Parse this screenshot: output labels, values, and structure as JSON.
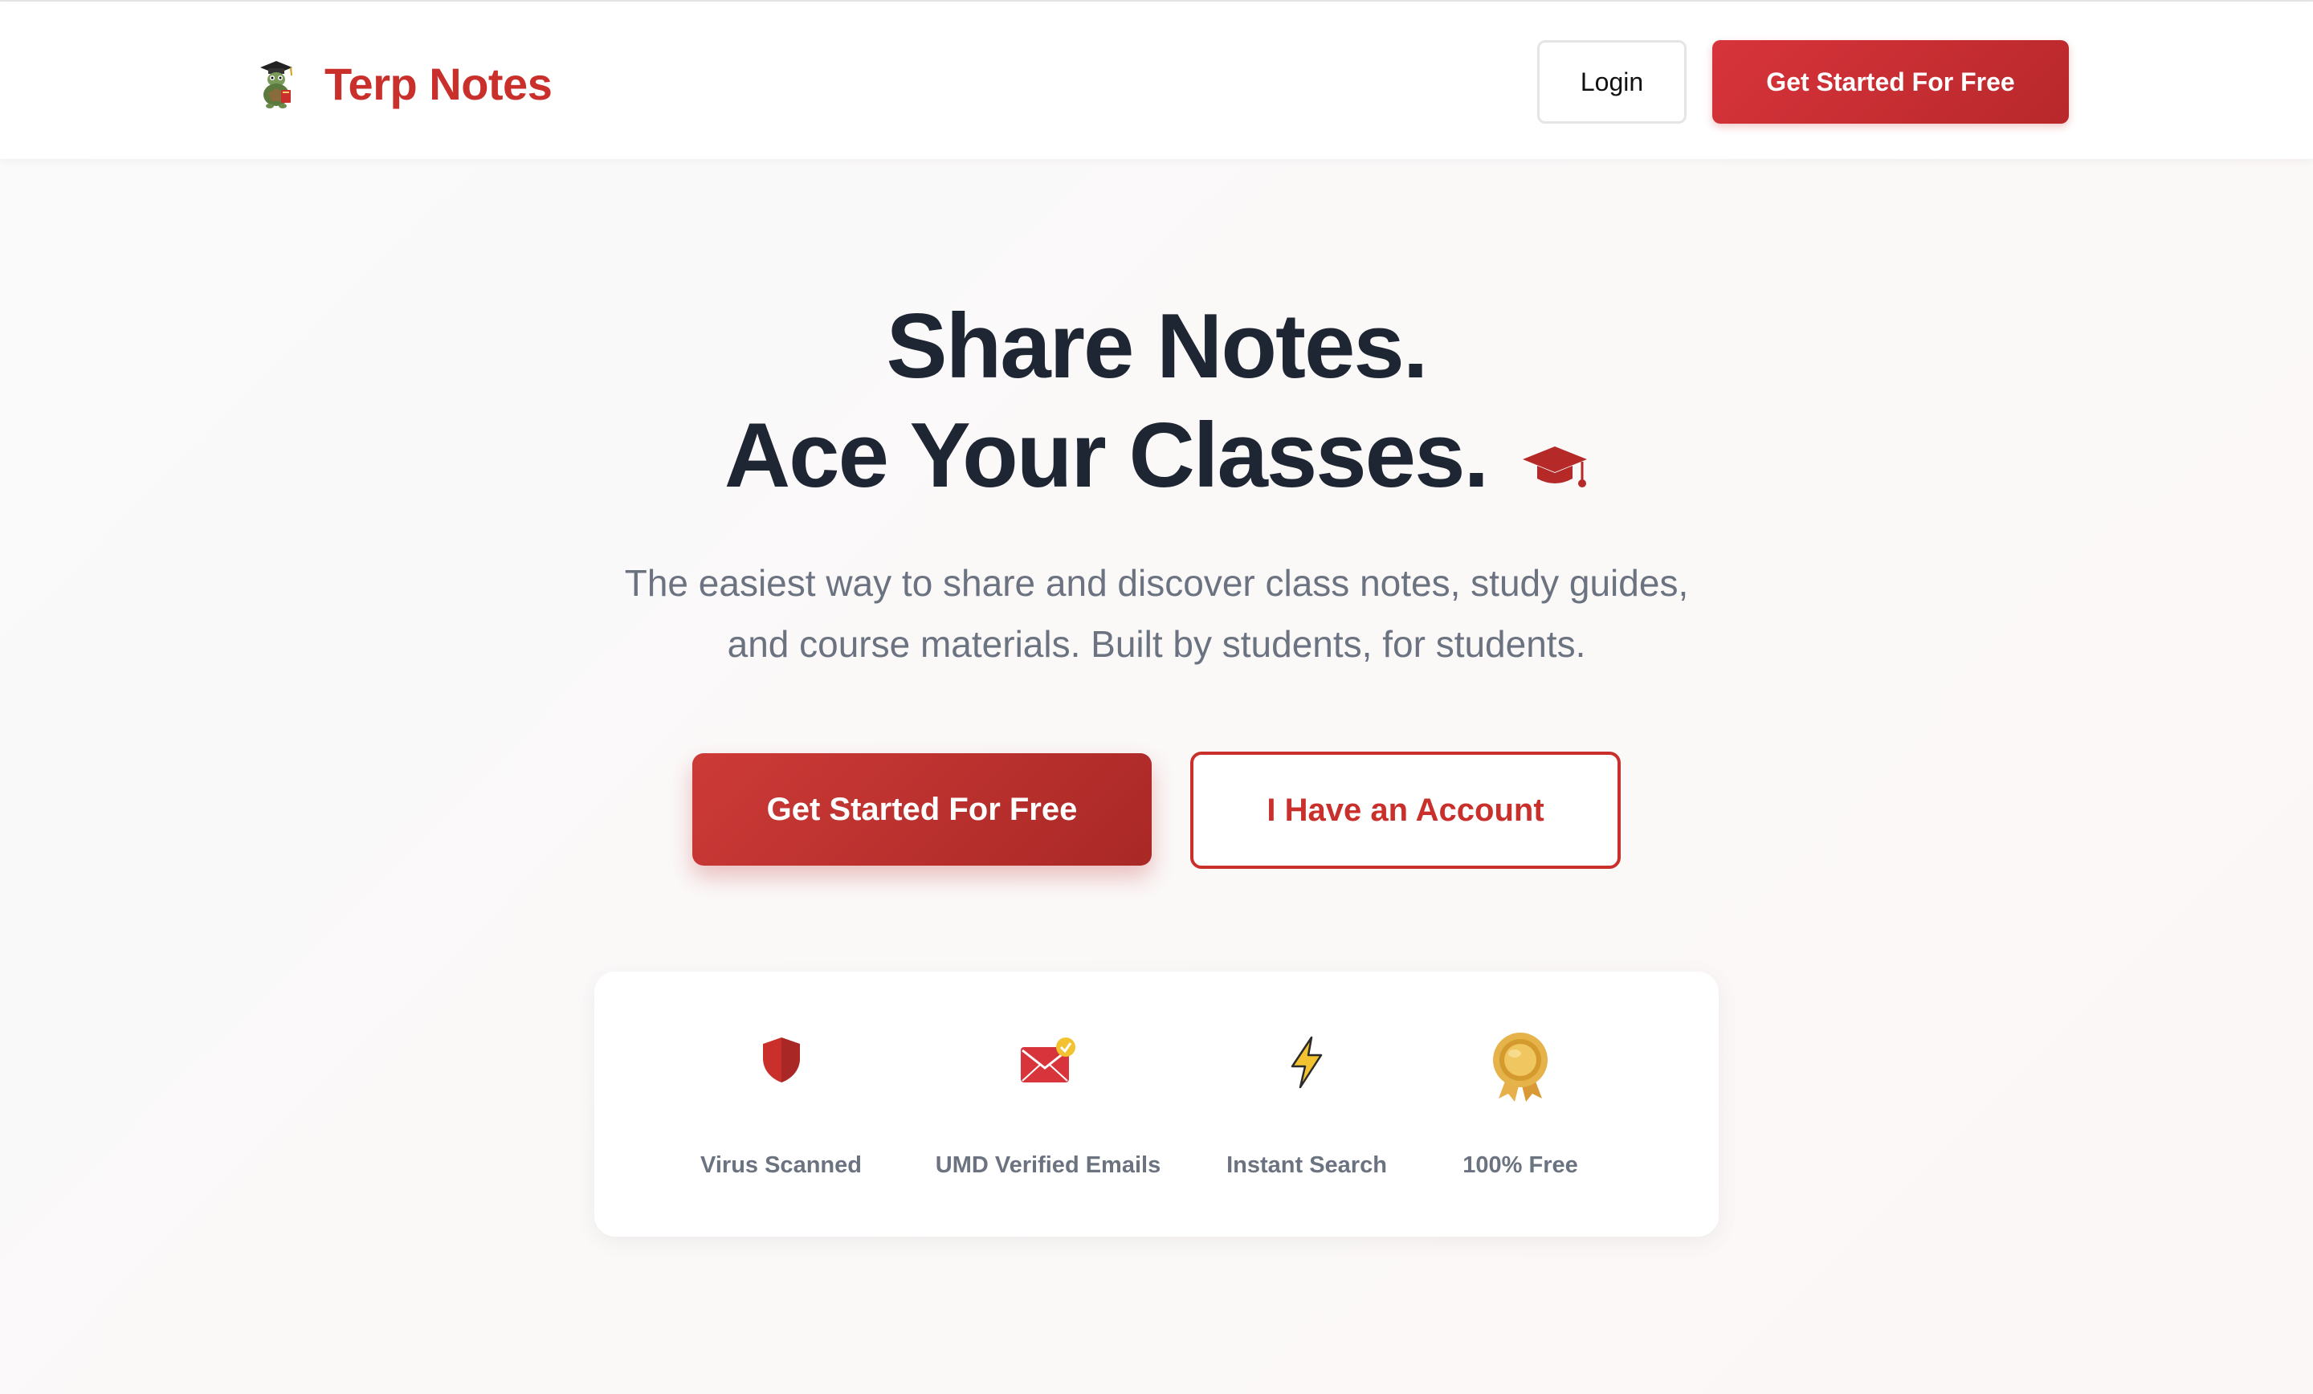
{
  "nav": {
    "brand": "Terp Notes",
    "login_label": "Login",
    "cta_label": "Get Started For Free",
    "logo_icon": "turtle-graduate-logo"
  },
  "hero": {
    "title_line1": "Share Notes.",
    "title_line2": "Ace Your Classes.",
    "title_icon": "graduation-cap-icon",
    "subtitle_line1": "The easiest way to share and discover class notes, study guides,",
    "subtitle_line2": "and course materials. Built by students, for students.",
    "primary_cta": "Get Started For Free",
    "secondary_cta": "I Have an Account"
  },
  "features": [
    {
      "label": "Virus Scanned",
      "icon": "shield-icon"
    },
    {
      "label": "UMD Verified Emails",
      "icon": "verified-email-icon"
    },
    {
      "label": "Instant Search",
      "icon": "lightning-bolt-icon"
    },
    {
      "label": "100% Free",
      "icon": "gold-medal-icon"
    }
  ],
  "colors": {
    "brand_red": "#c9302c",
    "heading_dark": "#1e2533",
    "muted_text": "#6b7280"
  }
}
